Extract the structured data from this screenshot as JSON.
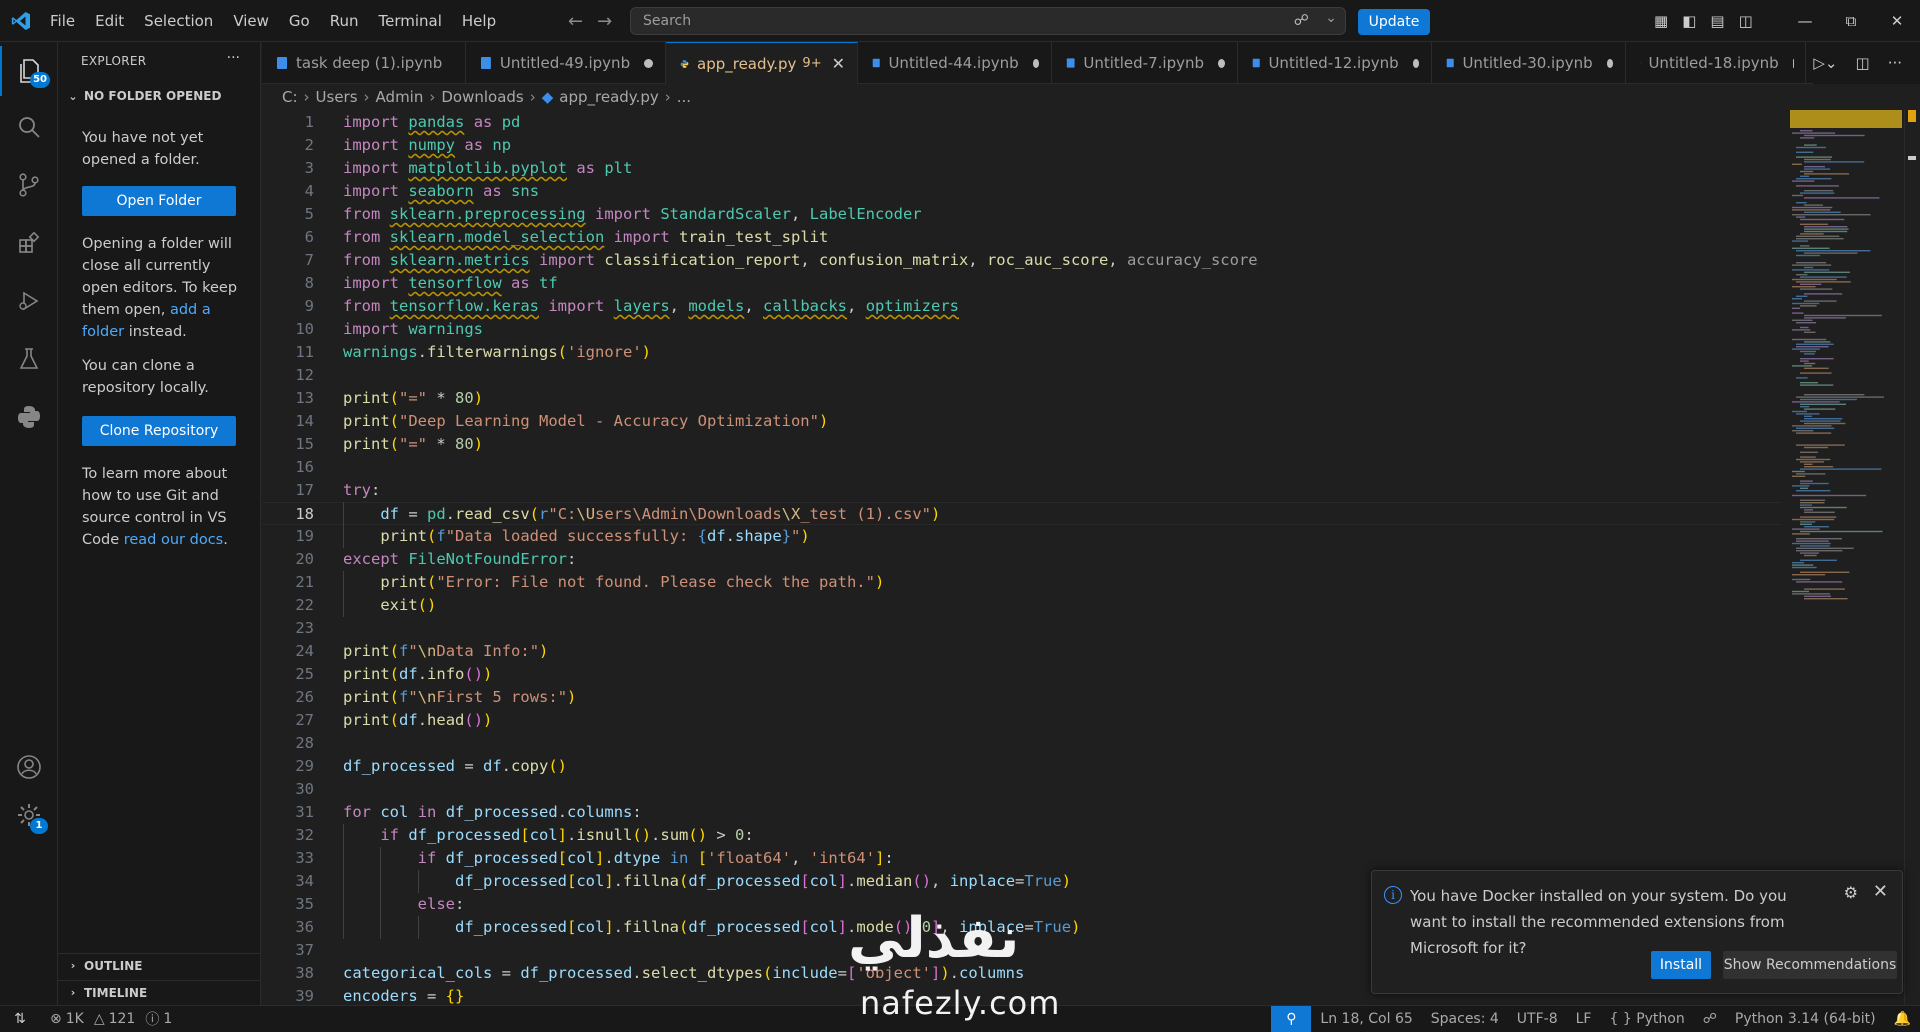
{
  "menu": [
    "File",
    "Edit",
    "Selection",
    "View",
    "Go",
    "Run",
    "Terminal",
    "Help"
  ],
  "search": {
    "placeholder": "Search"
  },
  "update_label": "Update",
  "activity": {
    "explorer_badge": "50",
    "settings_badge": "1"
  },
  "sidebar": {
    "title": "EXPLORER",
    "section": "NO FOLDER OPENED",
    "p1": "You have not yet opened a folder.",
    "open_folder": "Open Folder",
    "p2_before": "Opening a folder will close all currently open editors. To keep them open, ",
    "p2_link": "add a folder",
    "p2_after": " instead.",
    "p3": "You can clone a repository locally.",
    "clone": "Clone Repository",
    "p4_before": "To learn more about how to use Git and source control in VS Code ",
    "p4_link": "read our docs",
    "p4_after": ".",
    "outline": "OUTLINE",
    "timeline": "TIMELINE"
  },
  "tabs": [
    {
      "label": "task deep (1).ipynb",
      "kind": "notebook",
      "dirty": false
    },
    {
      "label": "Untitled-49.ipynb",
      "kind": "notebook",
      "dirty": true
    },
    {
      "label": "app_ready.py",
      "kind": "python",
      "active": true,
      "count": "9+"
    },
    {
      "label": "Untitled-44.ipynb",
      "kind": "notebook",
      "dirty": true
    },
    {
      "label": "Untitled-7.ipynb",
      "kind": "notebook",
      "dirty": true
    },
    {
      "label": "Untitled-12.ipynb",
      "kind": "notebook",
      "dirty": true
    },
    {
      "label": "Untitled-30.ipynb",
      "kind": "notebook",
      "dirty": true
    },
    {
      "label": "Untitled-18.ipynb",
      "kind": "notebook",
      "dirty": true
    }
  ],
  "breadcrumb": [
    "C:",
    "Users",
    "Admin",
    "Downloads",
    "app_ready.py",
    "..."
  ],
  "code_lines": [
    {
      "n": "1",
      "html": "<span class='kw'>import</span> <span class='mod sq'>pandas</span> <span class='kw'>as</span> <span class='mod'>pd</span>"
    },
    {
      "n": "2",
      "html": "<span class='kw'>import</span> <span class='mod sq'>numpy</span> <span class='kw'>as</span> <span class='mod'>np</span>"
    },
    {
      "n": "3",
      "html": "<span class='kw'>import</span> <span class='mod sq'>matplotlib.pyplot</span> <span class='kw'>as</span> <span class='mod'>plt</span>"
    },
    {
      "n": "4",
      "html": "<span class='kw'>import</span> <span class='mod sq'>seaborn</span> <span class='kw'>as</span> <span class='mod'>sns</span>"
    },
    {
      "n": "5",
      "html": "<span class='kw'>from</span> <span class='mod sq'>sklearn.preprocessing</span> <span class='kw'>import</span> <span class='cl'>StandardScaler</span>, <span class='cl'>LabelEncoder</span>"
    },
    {
      "n": "6",
      "html": "<span class='kw'>from</span> <span class='mod sq'>sklearn.model_selection</span> <span class='kw'>import</span> <span class='fn'>train_test_split</span>"
    },
    {
      "n": "7",
      "html": "<span class='kw'>from</span> <span class='mod sq'>sklearn.metrics</span> <span class='kw'>import</span> <span class='fn'>classification_report</span>, <span class='fn'>confusion_matrix</span>, <span class='fn'>roc_auc_score</span>, <span class='dim'>accuracy_score</span>"
    },
    {
      "n": "8",
      "html": "<span class='kw'>import</span> <span class='mod sq'>tensorflow</span> <span class='kw'>as</span> <span class='mod'>tf</span>"
    },
    {
      "n": "9",
      "html": "<span class='kw'>from</span> <span class='mod sq'>tensorflow.keras</span> <span class='kw'>import</span> <span class='mod sq'>layers</span>, <span class='mod sq'>models</span>, <span class='mod sq'>callbacks</span>, <span class='mod sq'>optimizers</span>"
    },
    {
      "n": "10",
      "html": "<span class='kw'>import</span> <span class='mod'>warnings</span>"
    },
    {
      "n": "11",
      "html": "<span class='mod'>warnings</span>.<span class='fn'>filterwarnings</span><span class='pa'>(</span><span class='st'>'ignore'</span><span class='pa'>)</span>"
    },
    {
      "n": "12",
      "html": ""
    },
    {
      "n": "13",
      "html": "<span class='fn'>print</span><span class='pa'>(</span><span class='st'>\"=\"</span> * <span class='nm'>80</span><span class='pa'>)</span>"
    },
    {
      "n": "14",
      "html": "<span class='fn'>print</span><span class='pa'>(</span><span class='st'>\"Deep Learning Model - Accuracy Optimization\"</span><span class='pa'>)</span>"
    },
    {
      "n": "15",
      "html": "<span class='fn'>print</span><span class='pa'>(</span><span class='st'>\"=\"</span> * <span class='nm'>80</span><span class='pa'>)</span>"
    },
    {
      "n": "16",
      "html": ""
    },
    {
      "n": "17",
      "html": "<span class='kw'>try</span>:"
    },
    {
      "n": "18",
      "html": "    <span class='vr'>df</span> = <span class='mod'>pd</span>.<span class='fn'>read_csv</span><span class='pa'>(</span><span class='kb'>r</span><span class='st'>\"C:</span><span class='esc'>\\U</span><span class='st'>sers\\Admin\\Downloads</span><span class='esc'>\\X</span><span class='st'>_test (1).csv\"</span><span class='pa'>)</span>"
    },
    {
      "n": "19",
      "html": "    <span class='fn'>print</span><span class='pa'>(</span><span class='kb'>f</span><span class='st'>\"Data loaded successfully: </span><span class='kb'>{</span><span class='vr'>df</span>.<span class='vr'>shape</span><span class='kb'>}</span><span class='st'>\"</span><span class='pa'>)</span>"
    },
    {
      "n": "20",
      "html": "<span class='kw'>except</span> <span class='cl'>FileNotFoundError</span>:"
    },
    {
      "n": "21",
      "html": "    <span class='fn'>print</span><span class='pa'>(</span><span class='st'>\"Error: File not found. Please check the path.\"</span><span class='pa'>)</span>"
    },
    {
      "n": "22",
      "html": "    <span class='fn'>exit</span><span class='pa'>()</span>"
    },
    {
      "n": "23",
      "html": ""
    },
    {
      "n": "24",
      "html": "<span class='fn'>print</span><span class='pa'>(</span><span class='kb'>f</span><span class='st'>\"</span><span class='esc'>\\n</span><span class='st'>Data Info:\"</span><span class='pa'>)</span>"
    },
    {
      "n": "25",
      "html": "<span class='fn'>print</span><span class='pa'>(</span><span class='vr'>df</span>.<span class='fn'>info</span><span class='pb'>()</span><span class='pa'>)</span>"
    },
    {
      "n": "26",
      "html": "<span class='fn'>print</span><span class='pa'>(</span><span class='kb'>f</span><span class='st'>\"</span><span class='esc'>\\n</span><span class='st'>First 5 rows:\"</span><span class='pa'>)</span>"
    },
    {
      "n": "27",
      "html": "<span class='fn'>print</span><span class='pa'>(</span><span class='vr'>df</span>.<span class='fn'>head</span><span class='pb'>()</span><span class='pa'>)</span>"
    },
    {
      "n": "28",
      "html": ""
    },
    {
      "n": "29",
      "html": "<span class='vr'>df_processed</span> = <span class='vr'>df</span>.<span class='fn'>copy</span><span class='pa'>()</span>"
    },
    {
      "n": "30",
      "html": ""
    },
    {
      "n": "31",
      "html": "<span class='kw'>for</span> <span class='vr'>col</span> <span class='kw'>in</span> <span class='vr'>df_processed</span>.<span class='vr'>columns</span>:"
    },
    {
      "n": "32",
      "html": "    <span class='kw'>if</span> <span class='vr'>df_processed</span><span class='pa'>[</span><span class='vr'>col</span><span class='pa'>]</span>.<span class='fn'>isnull</span><span class='pa'>()</span>.<span class='fn'>sum</span><span class='pa'>()</span> > <span class='nm'>0</span>:"
    },
    {
      "n": "33",
      "html": "        <span class='kw'>if</span> <span class='vr'>df_processed</span><span class='pa'>[</span><span class='vr'>col</span><span class='pa'>]</span>.<span class='vr'>dtype</span> <span class='kb'>in</span> <span class='pa'>[</span><span class='st'>'float64'</span>, <span class='st'>'int64'</span><span class='pa'>]</span>:"
    },
    {
      "n": "34",
      "html": "            <span class='vr'>df_processed</span><span class='pa'>[</span><span class='vr'>col</span><span class='pa'>]</span>.<span class='fn'>fillna</span><span class='pa'>(</span><span class='vr'>df_processed</span><span class='pb'>[</span><span class='vr'>col</span><span class='pb'>]</span>.<span class='fn'>median</span><span class='pb'>()</span>, <span class='vr'>inplace</span>=<span class='kb'>True</span><span class='pa'>)</span>"
    },
    {
      "n": "35",
      "html": "        <span class='kw'>else</span>:"
    },
    {
      "n": "36",
      "html": "            <span class='vr'>df_processed</span><span class='pa'>[</span><span class='vr'>col</span><span class='pa'>]</span>.<span class='fn'>fillna</span><span class='pa'>(</span><span class='vr'>df_processed</span><span class='pb'>[</span><span class='vr'>col</span><span class='pb'>]</span>.<span class='fn'>mode</span><span class='pb'>()</span><span class='pb'>[</span><span class='nm'>0</span><span class='pb'>]</span>, <span class='vr'>inplace</span>=<span class='kb'>True</span><span class='pa'>)</span>"
    },
    {
      "n": "37",
      "html": ""
    },
    {
      "n": "38",
      "html": "<span class='vr'>categorical_cols</span> = <span class='vr'>df_processed</span>.<span class='fn'>select_dtypes</span><span class='pa'>(</span><span class='vr'>include</span>=<span class='pb'>[</span><span class='st'>'object'</span><span class='pb'>]</span><span class='pa'>)</span>.<span class='vr'>columns</span>"
    },
    {
      "n": "39",
      "html": "<span class='vr'>encoders</span> = <span class='pa'>{}</span>"
    }
  ],
  "notification": {
    "message": "You have Docker installed on your system. Do you want to install the recommended extensions from Microsoft for it?",
    "install": "Install",
    "show_recommendations": "Show Recommendations"
  },
  "status": {
    "errors": "1K",
    "warnings": "121",
    "infos": "1",
    "cursor": "Ln 18, Col 65",
    "spaces": "Spaces: 4",
    "encoding": "UTF-8",
    "eol": "LF",
    "language": "Python",
    "interpreter": "Python 3.14 (64-bit)"
  },
  "watermark": {
    "arabic": "نفذلي",
    "latin": "nafezly.com"
  },
  "colors": {
    "accent": "#0e78d4",
    "background": "#1f1f1f",
    "sidebar": "#181818"
  }
}
